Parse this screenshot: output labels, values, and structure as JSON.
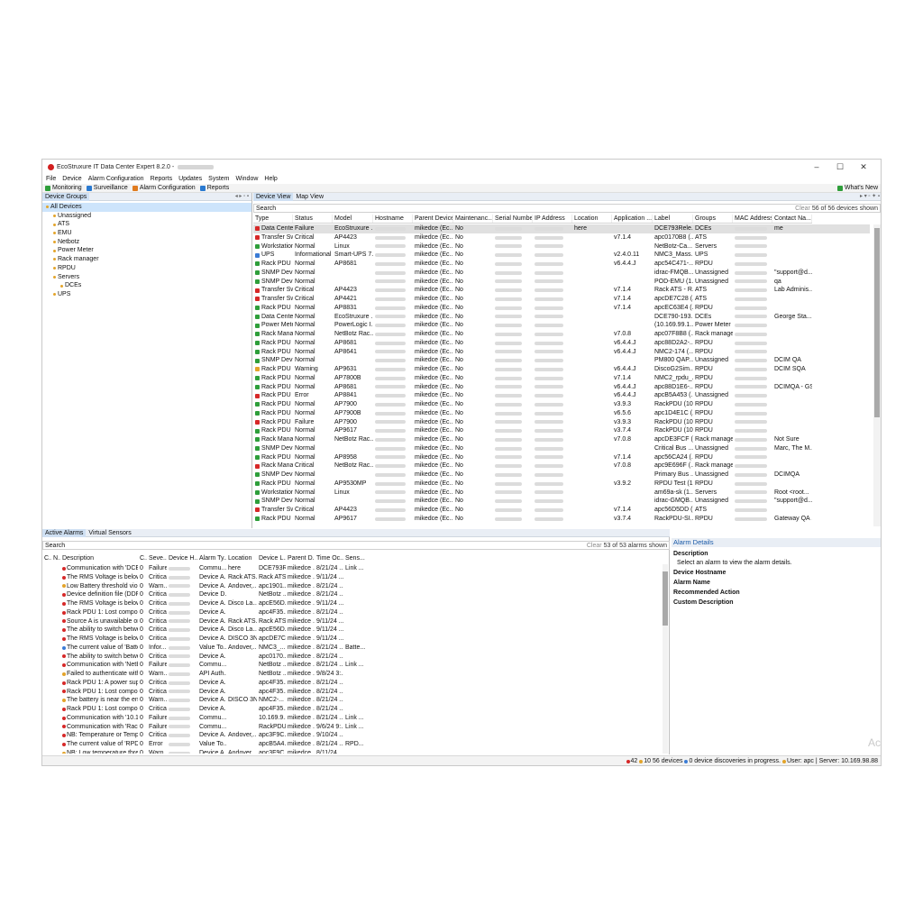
{
  "window": {
    "title": "EcoStruxure IT Data Center Expert 8.2.0 -",
    "controls": [
      "–",
      "☐",
      "✕"
    ]
  },
  "menu": [
    "File",
    "Device",
    "Alarm Configuration",
    "Reports",
    "Updates",
    "System",
    "Window",
    "Help"
  ],
  "toolbar": {
    "items": [
      {
        "label": "Monitoring",
        "color": "#2e9e3a"
      },
      {
        "label": "Surveillance",
        "color": "#2a7ad1"
      },
      {
        "label": "Alarm Configuration",
        "color": "#e07b1f"
      },
      {
        "label": "Reports",
        "color": "#2a7ad1"
      }
    ],
    "whats_new": "What's New"
  },
  "left_panel": {
    "tab": "Device Groups",
    "controls": "◂ ▸ ▫ ▪",
    "tree": [
      {
        "label": "All Devices",
        "indent": 0,
        "selected": true
      },
      {
        "label": "Unassigned",
        "indent": 1
      },
      {
        "label": "ATS",
        "indent": 1
      },
      {
        "label": "EMU",
        "indent": 1
      },
      {
        "label": "Netbotz",
        "indent": 1
      },
      {
        "label": "Power Meter",
        "indent": 1
      },
      {
        "label": "Rack manager",
        "indent": 1
      },
      {
        "label": "RPDU",
        "indent": 1
      },
      {
        "label": "Servers",
        "indent": 1
      },
      {
        "label": "DCEs",
        "indent": 2
      },
      {
        "label": "UPS",
        "indent": 1
      }
    ]
  },
  "device_view": {
    "tabs": [
      "Device View",
      "Map View"
    ],
    "search_placeholder": "Search",
    "clear_label": "Clear",
    "count_text": "56 of 56 devices shown",
    "columns": [
      "Type",
      "Status",
      "Model",
      "Hostname",
      "Parent Device",
      "Maintenanc...",
      "Serial Number",
      "IP Address",
      "Location",
      "Application ...",
      "Label",
      "Groups",
      "MAC Address",
      "Contact Na..."
    ],
    "rows": [
      [
        "Data Center",
        "Failure",
        "EcoStruxure ...",
        "",
        "mikedce (Ec...",
        "No",
        "",
        "",
        "here",
        "",
        "DCE793Rele...",
        "DCEs",
        "",
        "me"
      ],
      [
        "Transfer Swi",
        "Critical",
        "AP4423",
        "",
        "mikedce (Ec...",
        "No",
        "",
        "",
        "",
        "v7.1.4",
        "apc0170B8 (...",
        "ATS",
        "",
        ""
      ],
      [
        "Workstation",
        "Normal",
        "Linux",
        "",
        "mikedce (Ec...",
        "No",
        "",
        "",
        "",
        "",
        "NetBotz-Ca...",
        "Servers",
        "",
        ""
      ],
      [
        "UPS",
        "Informational",
        "Smart-UPS 7...",
        "",
        "mikedce (Ec...",
        "No",
        "",
        "",
        "",
        "v2.4.0.11",
        "NMC3_Mass...",
        "UPS",
        "",
        ""
      ],
      [
        "Rack PDU",
        "Normal",
        "AP8681",
        "",
        "mikedce (Ec...",
        "No",
        "",
        "",
        "",
        "v6.4.4.J",
        "apc54C471-...",
        "RPDU",
        "",
        ""
      ],
      [
        "SNMP Devi",
        "Normal",
        "",
        "",
        "mikedce (Ec...",
        "No",
        "",
        "",
        "",
        "",
        "idrac-FMQB...",
        "Unassigned",
        "",
        "\"support@d..."
      ],
      [
        "SNMP Devi",
        "Normal",
        "",
        "",
        "mikedce (Ec...",
        "No",
        "",
        "",
        "",
        "",
        "POD-EMU (1...",
        "Unassigned",
        "",
        "qa"
      ],
      [
        "Transfer Swi",
        "Critical",
        "AP4423",
        "",
        "mikedce (Ec...",
        "No",
        "",
        "",
        "",
        "v7.1.4",
        "Rack ATS - R...",
        "ATS",
        "",
        "Lab Adminis..."
      ],
      [
        "Transfer Swi",
        "Critical",
        "AP4421",
        "",
        "mikedce (Ec...",
        "No",
        "",
        "",
        "",
        "v7.1.4",
        "apcDE7C28 (...",
        "ATS",
        "",
        ""
      ],
      [
        "Rack PDU",
        "Normal",
        "AP8831",
        "",
        "mikedce (Ec...",
        "No",
        "",
        "",
        "",
        "v7.1.4",
        "apcEC63E4 (...",
        "RPDU",
        "",
        ""
      ],
      [
        "Data Center",
        "Normal",
        "EcoStruxure ...",
        "",
        "mikedce (Ec...",
        "No",
        "",
        "",
        "",
        "",
        "DCE790-193...",
        "DCEs",
        "",
        "George Sta..."
      ],
      [
        "Power Mete",
        "Normal",
        "PowerLogic I...",
        "",
        "mikedce (Ec...",
        "No",
        "",
        "",
        "",
        "",
        "(10.169.99.1...",
        "Power Meter",
        "",
        ""
      ],
      [
        "Rack Manag",
        "Normal",
        "NetBotz Rac...",
        "",
        "mikedce (Ec...",
        "No",
        "",
        "",
        "",
        "v7.0.8",
        "apc07F8B8 (...",
        "Rack manager",
        "",
        ""
      ],
      [
        "Rack PDU",
        "Normal",
        "AP8681",
        "",
        "mikedce (Ec...",
        "No",
        "",
        "",
        "",
        "v6.4.4.J",
        "apc88D2A2-...",
        "RPDU",
        "",
        ""
      ],
      [
        "Rack PDU",
        "Normal",
        "AP8641",
        "",
        "mikedce (Ec...",
        "No",
        "",
        "",
        "",
        "v6.4.4.J",
        "NMC2-174 (...",
        "RPDU",
        "",
        ""
      ],
      [
        "SNMP Devi",
        "Normal",
        "",
        "",
        "mikedce (Ec...",
        "No",
        "",
        "",
        "",
        "",
        "PM800 QAP...",
        "Unassigned",
        "",
        "DCIM QA"
      ],
      [
        "Rack PDU",
        "Warning",
        "AP9631",
        "",
        "mikedce (Ec...",
        "No",
        "",
        "",
        "",
        "v6.4.4.J",
        "DiscoG2Sim...",
        "RPDU",
        "",
        "DCIM SQA"
      ],
      [
        "Rack PDU",
        "Normal",
        "AP7800B",
        "",
        "mikedce (Ec...",
        "No",
        "",
        "",
        "",
        "v7.1.4",
        "NMC2_rpdu_...",
        "RPDU",
        "",
        ""
      ],
      [
        "Rack PDU",
        "Normal",
        "AP8681",
        "",
        "mikedce (Ec...",
        "No",
        "",
        "",
        "",
        "v6.4.4.J",
        "apc88D1E6-...",
        "RPDU",
        "",
        "DCIMQA - GS"
      ],
      [
        "Rack PDU",
        "Error",
        "AP8841",
        "",
        "mikedce (Ec...",
        "No",
        "",
        "",
        "",
        "v6.4.4.J",
        "apcB5A453 (...",
        "Unassigned",
        "",
        ""
      ],
      [
        "Rack PDU",
        "Normal",
        "AP7900",
        "",
        "mikedce (Ec...",
        "No",
        "",
        "",
        "",
        "v3.9.3",
        "RackPDU (10...",
        "RPDU",
        "",
        ""
      ],
      [
        "Rack PDU",
        "Normal",
        "AP7900B",
        "",
        "mikedce (Ec...",
        "No",
        "",
        "",
        "",
        "v6.5.6",
        "apc1D4E1C (...",
        "RPDU",
        "",
        ""
      ],
      [
        "Rack PDU",
        "Failure",
        "AP7900",
        "",
        "mikedce (Ec...",
        "No",
        "",
        "",
        "",
        "v3.9.3",
        "RackPDU (10...",
        "RPDU",
        "",
        ""
      ],
      [
        "Rack PDU",
        "Normal",
        "AP9617",
        "",
        "mikedce (Ec...",
        "No",
        "",
        "",
        "",
        "v3.7.4",
        "RackPDU (10...",
        "RPDU",
        "",
        ""
      ],
      [
        "Rack Manag",
        "Normal",
        "NetBotz Rac...",
        "",
        "mikedce (Ec...",
        "No",
        "",
        "",
        "",
        "v7.0.8",
        "apcDE3FCF (...",
        "Rack manager",
        "",
        "Not Sure"
      ],
      [
        "SNMP Devi",
        "Normal",
        "",
        "",
        "mikedce (Ec...",
        "No",
        "",
        "",
        "",
        "",
        "Critical Bus ...",
        "Unassigned",
        "",
        "Marc, The M..."
      ],
      [
        "Rack PDU",
        "Normal",
        "AP8958",
        "",
        "mikedce (Ec...",
        "No",
        "",
        "",
        "",
        "v7.1.4",
        "apc56CA24 (...",
        "RPDU",
        "",
        ""
      ],
      [
        "Rack Manag",
        "Critical",
        "NetBotz Rac...",
        "",
        "mikedce (Ec...",
        "No",
        "",
        "",
        "",
        "v7.0.8",
        "apc9E696F (...",
        "Rack manager",
        "",
        ""
      ],
      [
        "SNMP Devi",
        "Normal",
        "",
        "",
        "mikedce (Ec...",
        "No",
        "",
        "",
        "",
        "",
        "Primary Bus ...",
        "Unassigned",
        "",
        "DCIMQA"
      ],
      [
        "Rack PDU",
        "Normal",
        "AP9530MP",
        "",
        "mikedce (Ec...",
        "No",
        "",
        "",
        "",
        "v3.9.2",
        "RPDU Test (1...",
        "RPDU",
        "",
        ""
      ],
      [
        "Workstation",
        "Normal",
        "Linux",
        "",
        "mikedce (Ec...",
        "No",
        "",
        "",
        "",
        "",
        "am69a-sk (1...",
        "Servers",
        "",
        "Root <root..."
      ],
      [
        "SNMP Devi",
        "Normal",
        "",
        "",
        "mikedce (Ec...",
        "No",
        "",
        "",
        "",
        "",
        "idrac-GMQB...",
        "Unassigned",
        "",
        "\"support@d..."
      ],
      [
        "Transfer Swi",
        "Critical",
        "AP4423",
        "",
        "mikedce (Ec...",
        "No",
        "",
        "",
        "",
        "v7.1.4",
        "apc56D5DD (...",
        "ATS",
        "",
        ""
      ],
      [
        "Rack PDU",
        "Normal",
        "AP9617",
        "",
        "mikedce (Ec...",
        "No",
        "",
        "",
        "",
        "v3.7.4",
        "RackPDU-SI...",
        "RPDU",
        "",
        "Gateway QA ..."
      ]
    ]
  },
  "alarms": {
    "tabs": [
      "Active Alarms",
      "Virtual Sensors"
    ],
    "search_placeholder": "Search",
    "clear_label": "Clear",
    "count_text": "53 of 53 alarms shown",
    "columns": [
      "C...",
      "N...",
      "Description",
      "C...",
      "Seve...",
      "Device H...",
      "Alarm Ty...",
      "Location",
      "Device L...",
      "Parent D...",
      "Time Oc...",
      "Sens..."
    ],
    "rows": [
      [
        "Communication with 'DCE...",
        "0",
        "Failure",
        "",
        "Commu...",
        "here",
        "DCE793R...",
        "mikedce ...",
        "8/21/24 ...",
        "Link ..."
      ],
      [
        "The RMS Voltage is below ...",
        "0",
        "Critical",
        "",
        "Device A...",
        "Rack ATS...",
        "Rack ATS...",
        "mikedce ...",
        "9/11/24 ...",
        ""
      ],
      [
        "Low Battery threshold viol...",
        "0",
        "Warn...",
        "",
        "Device A...",
        "Andover,...",
        "apc1901...",
        "mikedce ...",
        "8/21/24 ...",
        ""
      ],
      [
        "Device definition file (DDF)...",
        "0",
        "Critical",
        "",
        "Device D...",
        "",
        "NetBotz ...",
        "mikedce ...",
        "8/21/24 ...",
        ""
      ],
      [
        "The RMS Voltage is below ...",
        "0",
        "Critical",
        "",
        "Device A...",
        "Disco La...",
        "apcE56D...",
        "mikedce ...",
        "9/11/24 ...",
        ""
      ],
      [
        "Rack PDU 1: Lost compon...",
        "0",
        "Critical",
        "",
        "Device A...",
        "",
        "apc4F35...",
        "mikedce ...",
        "8/21/24 ...",
        ""
      ],
      [
        "Source A is unavailable or ...",
        "0",
        "Critical",
        "",
        "Device A...",
        "Rack ATS...",
        "Rack ATS...",
        "mikedce ...",
        "9/11/24 ...",
        ""
      ],
      [
        "The ability to switch betwe...",
        "0",
        "Critical",
        "",
        "Device A...",
        "Disco La...",
        "apcE56D...",
        "mikedce ...",
        "9/11/24 ...",
        ""
      ],
      [
        "The RMS Voltage is below ...",
        "0",
        "Critical",
        "",
        "Device A...",
        "DISCO 3N",
        "apcDE7C...",
        "mikedce ...",
        "9/11/24 ...",
        ""
      ],
      [
        "The current value of 'Batte...",
        "0",
        "Infor...",
        "",
        "Value To...",
        "Andover,...",
        "NMC3_...",
        "mikedce ...",
        "8/21/24 ...",
        "Batte..."
      ],
      [
        "The ability to switch betwe...",
        "0",
        "Critical",
        "",
        "Device A...",
        "",
        "apc0170...",
        "mikedce ...",
        "8/21/24 ...",
        ""
      ],
      [
        "Communication with 'NetB...",
        "0",
        "Failure",
        "",
        "Commu...",
        "",
        "NetBotz ...",
        "mikedce ...",
        "8/21/24 ...",
        "Link ..."
      ],
      [
        "Failed to authenticate with...",
        "0",
        "Warn...",
        "",
        "API Auth...",
        "",
        "NetBotz ...",
        "mikedce ...",
        "9/8/24 3:...",
        ""
      ],
      [
        "Rack PDU 1: A power supp...",
        "0",
        "Critical",
        "",
        "Device A...",
        "",
        "apc4F35...",
        "mikedce ...",
        "8/21/24 ...",
        ""
      ],
      [
        "Rack PDU 1: Lost compon...",
        "0",
        "Critical",
        "",
        "Device A...",
        "",
        "apc4F35...",
        "mikedce ...",
        "8/21/24 ...",
        ""
      ],
      [
        "The battery is near the end...",
        "0",
        "Warn...",
        "",
        "Device A...",
        "DISCO 3N",
        "NMC2-...",
        "mikedce ...",
        "8/21/24 ...",
        ""
      ],
      [
        "Rack PDU 1: Lost compon...",
        "0",
        "Critical",
        "",
        "Device A...",
        "",
        "apc4F35...",
        "mikedce ...",
        "8/21/24 ...",
        ""
      ],
      [
        "Communication with '10.1...",
        "0",
        "Failure",
        "",
        "Commu...",
        "",
        "10.169.9...",
        "mikedce ...",
        "8/21/24 ...",
        "Link ..."
      ],
      [
        "Communication with 'Rack...",
        "0",
        "Failure",
        "",
        "Commu...",
        "",
        "RackPDU...",
        "mikedce ...",
        "9/6/24 9:...",
        "Link ..."
      ],
      [
        "NB: Temperature or Tempe...",
        "0",
        "Critical",
        "",
        "Device A...",
        "Andover,...",
        "apc3F9C...",
        "mikedce ...",
        "9/10/24 ...",
        ""
      ],
      [
        "The current value of 'RPDU...",
        "0",
        "Error",
        "",
        "Value To...",
        "",
        "apcB5A4...",
        "mikedce ...",
        "8/21/24 ...",
        "RPD..."
      ],
      [
        "NB: Low temperature thres...",
        "0",
        "Warn...",
        "",
        "Device A...",
        "Andover,...",
        "apc3F9C...",
        "mikedce ...",
        "8/11/24 ...",
        ""
      ]
    ]
  },
  "details": {
    "title": "Alarm Details",
    "sections": [
      {
        "heading": "Description",
        "text": "Select an alarm to view the alarm details."
      },
      {
        "heading": "Device Hostname",
        "text": ""
      },
      {
        "heading": "Alarm Name",
        "text": ""
      },
      {
        "heading": "Recommended Action",
        "text": ""
      },
      {
        "heading": "Custom Description",
        "text": ""
      }
    ]
  },
  "status": {
    "critical_count": "42",
    "warning_count": "10",
    "devices_text": "56 devices",
    "discoveries_text": "0 device discoveries in progress.",
    "user_server_text": "User: apc | Server: 10.169.98.88"
  },
  "watermark": "Ac",
  "colors": {
    "critical": "#d62828",
    "warning": "#e3a42a",
    "info": "#3a7bd5",
    "normal": "#2e9e3a",
    "accent": "#1a5aa8"
  }
}
